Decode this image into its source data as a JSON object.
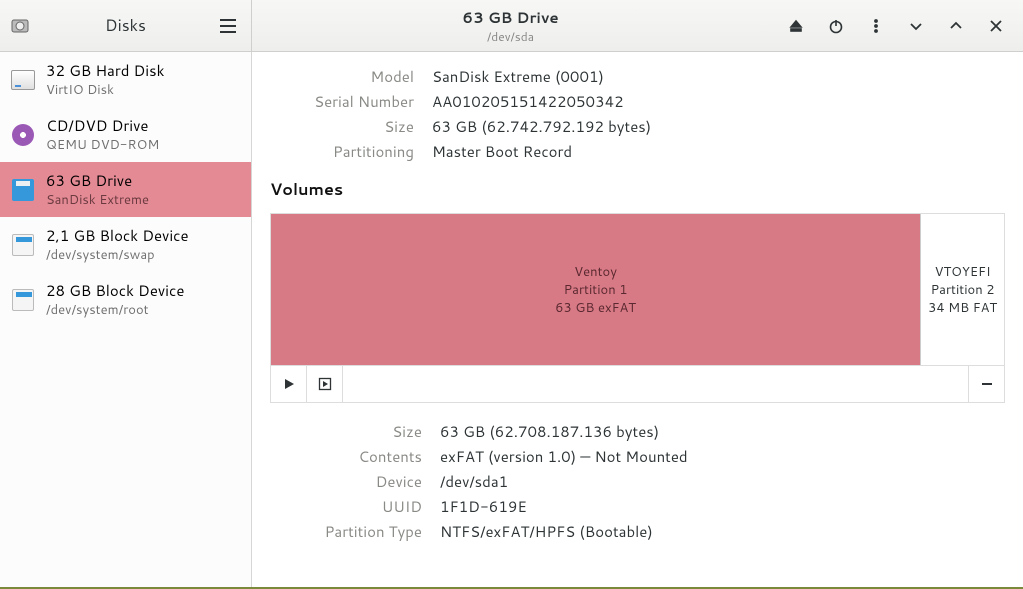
{
  "header": {
    "app_title": "Disks",
    "drive_title": "63 GB Drive",
    "drive_sub": "/dev/sda"
  },
  "sidebar": {
    "items": [
      {
        "name": "32 GB Hard Disk",
        "sub": "VirtIO Disk",
        "icon": "hdd",
        "selected": false
      },
      {
        "name": "CD/DVD Drive",
        "sub": "QEMU DVD-ROM",
        "icon": "cd",
        "selected": false
      },
      {
        "name": "63 GB Drive",
        "sub": "SanDisk Extreme",
        "icon": "usb",
        "selected": true
      },
      {
        "name": "2,1 GB Block Device",
        "sub": "/dev/system/swap",
        "icon": "blk",
        "selected": false
      },
      {
        "name": "28 GB Block Device",
        "sub": "/dev/system/root",
        "icon": "blk",
        "selected": false
      }
    ]
  },
  "drive_info": {
    "model_label": "Model",
    "model": "SanDisk Extreme (0001)",
    "serial_label": "Serial Number",
    "serial": "AA010205151422050342",
    "size_label": "Size",
    "size": "63 GB (62.742.792.192 bytes)",
    "part_label": "Partitioning",
    "partitioning": "Master Boot Record"
  },
  "volumes": {
    "title": "Volumes",
    "partitions": [
      {
        "name": "Ventoy",
        "line2": "Partition 1",
        "line3": "63 GB exFAT",
        "selected": true,
        "flex": 12
      },
      {
        "name": "VTOYEFI",
        "line2": "Partition 2",
        "line3": "34 MB FAT",
        "selected": false,
        "flex": 1.4
      }
    ]
  },
  "part_info": {
    "size_label": "Size",
    "size": "63 GB (62.708.187.136 bytes)",
    "contents_label": "Contents",
    "contents": "exFAT (version 1.0) — Not Mounted",
    "device_label": "Device",
    "device": "/dev/sda1",
    "uuid_label": "UUID",
    "uuid": "1F1D-619E",
    "ptype_label": "Partition Type",
    "ptype": "NTFS/exFAT/HPFS (Bootable)"
  }
}
